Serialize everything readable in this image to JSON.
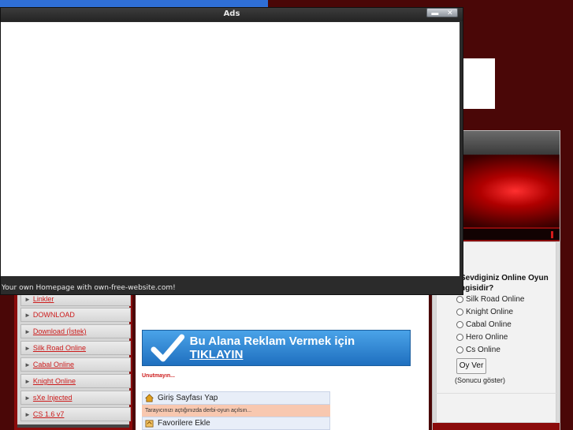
{
  "ads_window": {
    "title": "Ads",
    "footer": "Your own Homepage with own-free-website.com!",
    "controls": [
      "minimize-icon",
      "close-icon"
    ]
  },
  "poll": {
    "question": "Sevdiginiz Online Oyun ngisidir?",
    "options": [
      "Silk Road Online",
      "Knight Online",
      "Cabal Online",
      "Hero Online",
      "Cs Online"
    ],
    "vote_button": "Oy Ver",
    "show_results": "(Sonucu göster)"
  },
  "sidebar": {
    "items": [
      {
        "label": "Linkler",
        "link": true
      },
      {
        "label": "DOWNLOAD",
        "link": false
      },
      {
        "label": "Download (İstek)",
        "link": true
      },
      {
        "label": "Silk Road Online",
        "link": true
      },
      {
        "label": "Cabal Online",
        "link": true
      },
      {
        "label": "Knight Online",
        "link": true
      },
      {
        "label": "sXe Injected",
        "link": true
      },
      {
        "label": "CS 1.6 v7",
        "link": true
      }
    ],
    "bullet": "►"
  },
  "center": {
    "ad_banner_text": "Bu Alana Reklam Vermek için",
    "ad_banner_link": "TIKLAYIN",
    "reminder": "Unutmayın...",
    "homepage_action": "Giriş Sayfası Yap",
    "notice": "Tarayıcınızı açtığınızda derbi-oyun açılsın...",
    "favorites_action": "Favorilere Ekle"
  },
  "colors": {
    "background": "#4a0707",
    "accent_red": "#cc1b1b",
    "sidebar_red": "#8b0b0b",
    "banner_blue": "#2f86d6"
  }
}
